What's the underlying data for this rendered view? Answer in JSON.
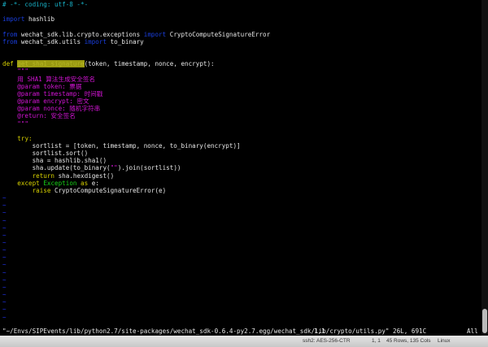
{
  "code": {
    "l1": "# -*- coding: utf-8 -*-",
    "import_kw": "import",
    "hashlib": " hashlib",
    "from_kw": "from",
    "mod1": " wechat_sdk.lib.crypto.exceptions ",
    "import2": "import",
    "name1": " CryptoComputeSignatureError",
    "mod2": " wechat_sdk.utils ",
    "name2": " to_binary",
    "def_kw": "def",
    "func": "get_sha1_signature",
    "params": "(token, timestamp, nonce, encrypt):",
    "doc_q": "    \"\"\"",
    "doc1": "    用 SHA1 算法生成安全签名",
    "doc2": "    @param token: 票据",
    "doc3": "    @param timestamp: 时间戳",
    "doc4": "    @param encrypt: 密文",
    "doc5": "    @param nonce: 随机字符串",
    "doc6": "    @return: 安全签名",
    "try": "try:",
    "s1": "        sortlist = [token, timestamp, nonce, to_binary(encrypt)]",
    "s2": "        sortlist.sort()",
    "s3": "        sha = hashlib.sha1()",
    "s4a": "        sha.update(to_binary(",
    "s4q": "\"\"",
    "s4b": ").join(sortlist))",
    "ret": "return",
    "s5": " sha.hexdigest()",
    "except": "except",
    "exc": "Exception",
    "as": " as",
    "s6": " e:",
    "raise": "raise",
    "s7": " CryptoComputeSignatureError(e)"
  },
  "tilde": "~",
  "vim_status": {
    "file": "\"~/Envs/SIPEvents/lib/python2.7/site-packages/wechat_sdk-0.6.4-py2.7.egg/wechat_sdk/lib/crypto/utils.py\" 26L, 691C",
    "pos": "1,1",
    "all": "All"
  },
  "window_status": {
    "cipher": "ssh2: AES-256-CTR",
    "pos": "1, 1",
    "size": "45 Rows, 135 Cols",
    "os": "Linux"
  }
}
